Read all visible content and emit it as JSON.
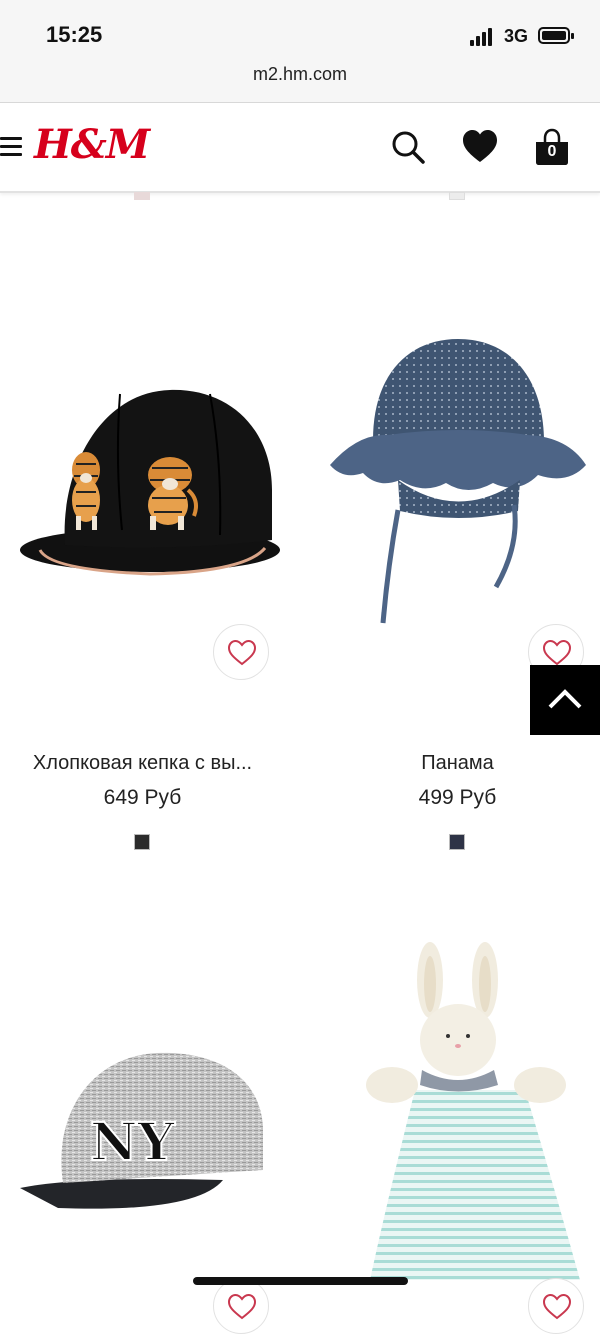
{
  "status_bar": {
    "time": "15:25",
    "network": "3G"
  },
  "browser": {
    "url": "m2.hm.com"
  },
  "header": {
    "logo": "H&M",
    "cart_count": "0"
  },
  "products": [
    {
      "name": "Хлопковая кепка с вы...",
      "price": "649 Руб",
      "swatch_color": "#2b2b2b"
    },
    {
      "name": "Панама",
      "price": "499 Руб",
      "swatch_color": "#2e3346"
    }
  ],
  "icons": {
    "menu": "hamburger-icon",
    "search": "search-icon",
    "favorites": "heart-icon",
    "cart": "shopping-bag-icon",
    "wishlist": "heart-outline-icon",
    "scroll_top": "chevron-up-icon"
  },
  "colors": {
    "brand": "#d6001c",
    "wishlist_heart": "#c9384f"
  }
}
